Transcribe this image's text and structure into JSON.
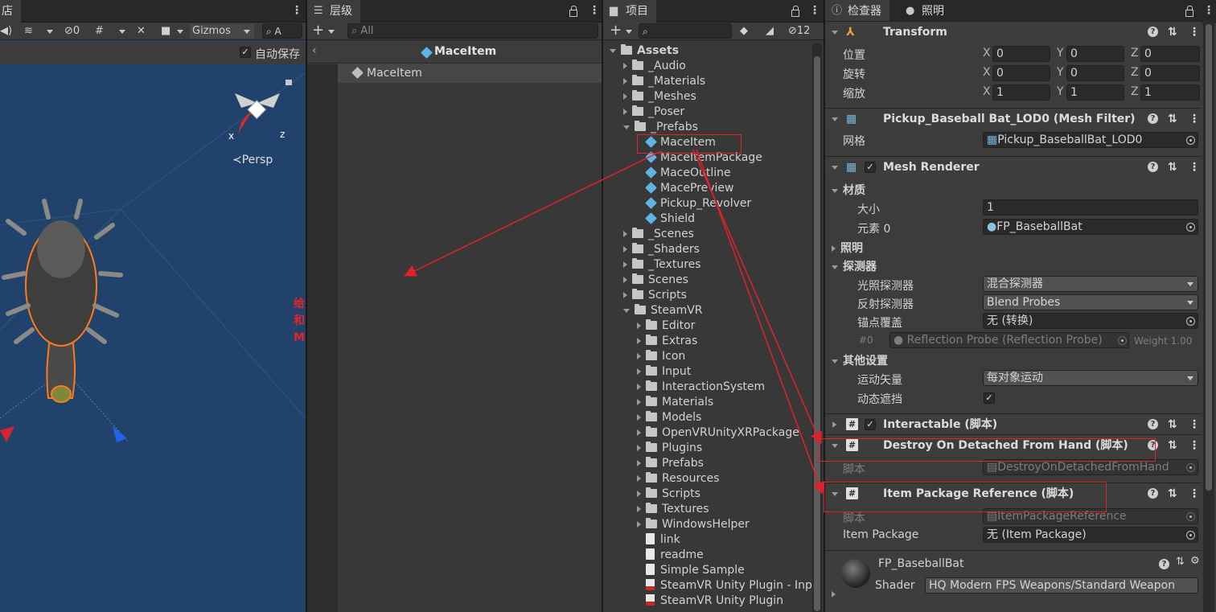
{
  "scene": {
    "tab_label": "店",
    "gizmos_label": "Gizmos",
    "visibility_count": "0",
    "search_placeholder": "A",
    "auto_save_label": "自动保存",
    "persp_label": "≺Persp",
    "axis_x": "x",
    "axis_z": "z",
    "annotation_lines": [
      "给拾取时的预制体挂载上松开时销毁实例的脚本",
      "和ItemPackageReference脚本让其与游戏列表",
      "MaceItemPackage进行关联"
    ],
    "colors": {
      "background": "#21426a",
      "annotation": "#e8222a",
      "highlight": "#ff7a1f"
    }
  },
  "hierarchy": {
    "tab_label": "层级",
    "search_placeholder": "All",
    "breadcrumb_title": "MaceItem",
    "root_item": "MaceItem"
  },
  "project": {
    "tab_label": "项目",
    "hidden_count": "12",
    "root": "Assets",
    "items": [
      {
        "label": "_Audio",
        "kind": "folder",
        "depth": 1,
        "state": "closed"
      },
      {
        "label": "_Materials",
        "kind": "folder",
        "depth": 1,
        "state": "closed"
      },
      {
        "label": "_Meshes",
        "kind": "folder",
        "depth": 1,
        "state": "closed"
      },
      {
        "label": "_Poser",
        "kind": "folder",
        "depth": 1,
        "state": "closed"
      },
      {
        "label": "_Prefabs",
        "kind": "folder",
        "depth": 1,
        "state": "open"
      },
      {
        "label": "MaceItem",
        "kind": "prefab",
        "depth": 2,
        "state": "none"
      },
      {
        "label": "MaceItemPackage",
        "kind": "prefab",
        "depth": 2,
        "state": "none"
      },
      {
        "label": "MaceOutline",
        "kind": "prefab",
        "depth": 2,
        "state": "none"
      },
      {
        "label": "MacePreview",
        "kind": "prefab",
        "depth": 2,
        "state": "none"
      },
      {
        "label": "Pickup_Revolver",
        "kind": "prefab",
        "depth": 2,
        "state": "none"
      },
      {
        "label": "Shield",
        "kind": "prefab",
        "depth": 2,
        "state": "none"
      },
      {
        "label": "_Scenes",
        "kind": "folder",
        "depth": 1,
        "state": "closed"
      },
      {
        "label": "_Shaders",
        "kind": "folder",
        "depth": 1,
        "state": "closed"
      },
      {
        "label": "_Textures",
        "kind": "folder",
        "depth": 1,
        "state": "closed"
      },
      {
        "label": "Scenes",
        "kind": "folder",
        "depth": 1,
        "state": "closed"
      },
      {
        "label": "Scripts",
        "kind": "folder",
        "depth": 1,
        "state": "closed"
      },
      {
        "label": "SteamVR",
        "kind": "folder",
        "depth": 1,
        "state": "open"
      },
      {
        "label": "Editor",
        "kind": "folder",
        "depth": 2,
        "state": "closed"
      },
      {
        "label": "Extras",
        "kind": "folder",
        "depth": 2,
        "state": "closed"
      },
      {
        "label": "Icon",
        "kind": "folder",
        "depth": 2,
        "state": "closed"
      },
      {
        "label": "Input",
        "kind": "folder",
        "depth": 2,
        "state": "closed"
      },
      {
        "label": "InteractionSystem",
        "kind": "folder",
        "depth": 2,
        "state": "closed"
      },
      {
        "label": "Materials",
        "kind": "folder",
        "depth": 2,
        "state": "closed"
      },
      {
        "label": "Models",
        "kind": "folder",
        "depth": 2,
        "state": "closed"
      },
      {
        "label": "OpenVRUnityXRPackage",
        "kind": "folder",
        "depth": 2,
        "state": "closed"
      },
      {
        "label": "Plugins",
        "kind": "folder",
        "depth": 2,
        "state": "closed"
      },
      {
        "label": "Prefabs",
        "kind": "folder",
        "depth": 2,
        "state": "closed"
      },
      {
        "label": "Resources",
        "kind": "folder",
        "depth": 2,
        "state": "closed"
      },
      {
        "label": "Scripts",
        "kind": "folder",
        "depth": 2,
        "state": "closed"
      },
      {
        "label": "Textures",
        "kind": "folder",
        "depth": 2,
        "state": "closed"
      },
      {
        "label": "WindowsHelper",
        "kind": "folder",
        "depth": 2,
        "state": "closed"
      },
      {
        "label": "link",
        "kind": "file",
        "depth": 2,
        "state": "none"
      },
      {
        "label": "readme",
        "kind": "file",
        "depth": 2,
        "state": "none"
      },
      {
        "label": "Simple Sample",
        "kind": "scene",
        "depth": 2,
        "state": "none"
      },
      {
        "label": "SteamVR Unity Plugin - Inp",
        "kind": "pdf",
        "depth": 2,
        "state": "none"
      },
      {
        "label": "SteamVR Unity Plugin",
        "kind": "pdf",
        "depth": 2,
        "state": "none"
      }
    ]
  },
  "inspector": {
    "tab_inspector": "检查器",
    "tab_lighting": "照明",
    "transform": {
      "title": "Transform",
      "rows": [
        {
          "label": "位置",
          "x": "0",
          "y": "0",
          "z": "0"
        },
        {
          "label": "旋转",
          "x": "0",
          "y": "0",
          "z": "0"
        },
        {
          "label": "缩放",
          "x": "1",
          "y": "1",
          "z": "1"
        }
      ],
      "x_label": "X",
      "y_label": "Y",
      "z_label": "Z"
    },
    "mesh_filter": {
      "title": "Pickup_Baseball Bat_LOD0 (Mesh Filter)",
      "mesh_label": "网格",
      "mesh_value": "Pickup_BaseballBat_LOD0"
    },
    "mesh_renderer": {
      "title": "Mesh Renderer",
      "materials_label": "材质",
      "size_label": "大小",
      "size_value": "1",
      "element_label": "元素 0",
      "element_value": "FP_BaseballBat",
      "lighting_label": "照明",
      "probes_label": "探测器",
      "light_probes_label": "光照探测器",
      "light_probes_value": "混合探测器",
      "reflection_probes_label": "反射探测器",
      "reflection_probes_value": "Blend Probes",
      "anchor_label": "锚点覆盖",
      "anchor_value": "无 (转换)",
      "probe_index": "#0",
      "probe_value": "Reflection Probe (Reflection Probe)",
      "probe_weight": "Weight 1.00",
      "other_label": "其他设置",
      "motion_label": "运动矢量",
      "motion_value": "每对象运动",
      "dynamic_label": "动态遮挡"
    },
    "interactable": {
      "title": "Interactable  (脚本)"
    },
    "destroy": {
      "title": "Destroy On Detached From Hand  (脚本)",
      "script_label": "脚本",
      "script_value": "DestroyOnDetachedFromHand"
    },
    "item_package_ref": {
      "title": "Item Package Reference  (脚本)",
      "script_label": "脚本",
      "script_value": "ItemPackageReference",
      "package_label": "Item Package",
      "package_value": "无 (Item Package)"
    },
    "material": {
      "name": "FP_BaseballBat",
      "shader_label": "Shader",
      "shader_value": "HQ Modern FPS Weapons/Standard Weapon"
    }
  }
}
